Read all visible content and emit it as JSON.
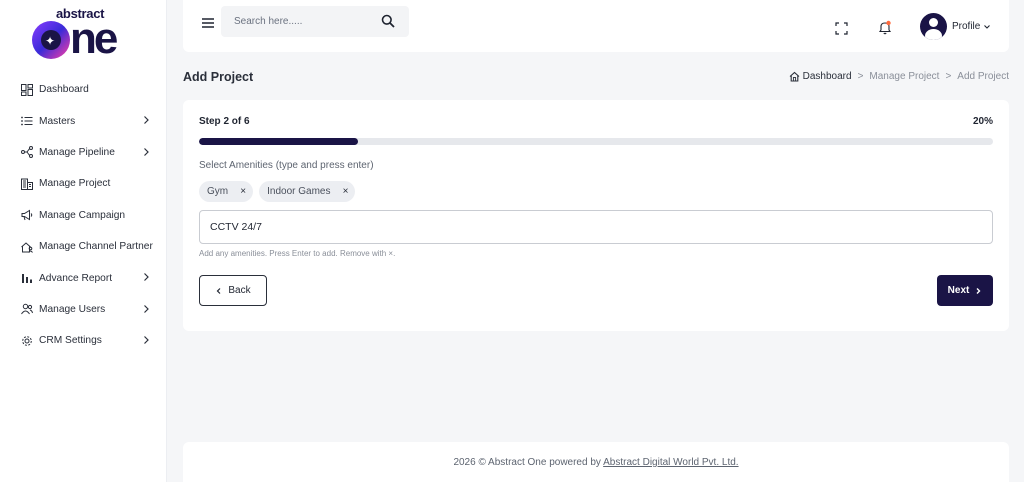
{
  "brand": {
    "logo_top": "abstract",
    "logo_bottom_o": "o",
    "logo_bottom_rest": "ne"
  },
  "sidebar": {
    "items": [
      {
        "label": "Dashboard",
        "icon": "dashboard-icon",
        "has_submenu": false
      },
      {
        "label": "Masters",
        "icon": "list-icon",
        "has_submenu": true
      },
      {
        "label": "Manage Pipeline",
        "icon": "pipeline-icon",
        "has_submenu": true
      },
      {
        "label": "Manage Project",
        "icon": "building-icon",
        "has_submenu": false
      },
      {
        "label": "Manage Campaign",
        "icon": "megaphone-icon",
        "has_submenu": false
      },
      {
        "label": "Manage Channel Partner",
        "icon": "home-group-icon",
        "has_submenu": false
      },
      {
        "label": "Advance Report",
        "icon": "bar-chart-icon",
        "has_submenu": true
      },
      {
        "label": "Manage Users",
        "icon": "users-icon",
        "has_submenu": true
      },
      {
        "label": "CRM Settings",
        "icon": "gear-icon",
        "has_submenu": true
      }
    ]
  },
  "header": {
    "search_placeholder": "Search here.....",
    "profile_label": "Profile"
  },
  "page": {
    "title": "Add Project",
    "breadcrumb": {
      "home": "Dashboard",
      "mid": "Manage Project",
      "current": "Add Project",
      "separator": ">"
    }
  },
  "wizard": {
    "step_label": "Step 2 of 6",
    "progress_percent_label": "20%",
    "progress": 0.2,
    "amenities_label": "Select Amenities (type and press enter)",
    "chips": [
      {
        "label": "Gym",
        "remove": "×"
      },
      {
        "label": "Indoor Games",
        "remove": "×"
      }
    ],
    "input_value": "CCTV 24/7",
    "hint": "Add any amenities. Press Enter to add. Remove with ×.",
    "back_label": "Back",
    "next_label": "Next"
  },
  "footer": {
    "text": "2026 © Abstract One powered by",
    "link": "Abstract Digital World Pvt. Ltd."
  },
  "colors": {
    "brand": "#1a1446",
    "bell_dot": "#ff6a3d",
    "accent_gradient_start": "#8b3dff",
    "accent_gradient_end": "#ff3fa4"
  }
}
